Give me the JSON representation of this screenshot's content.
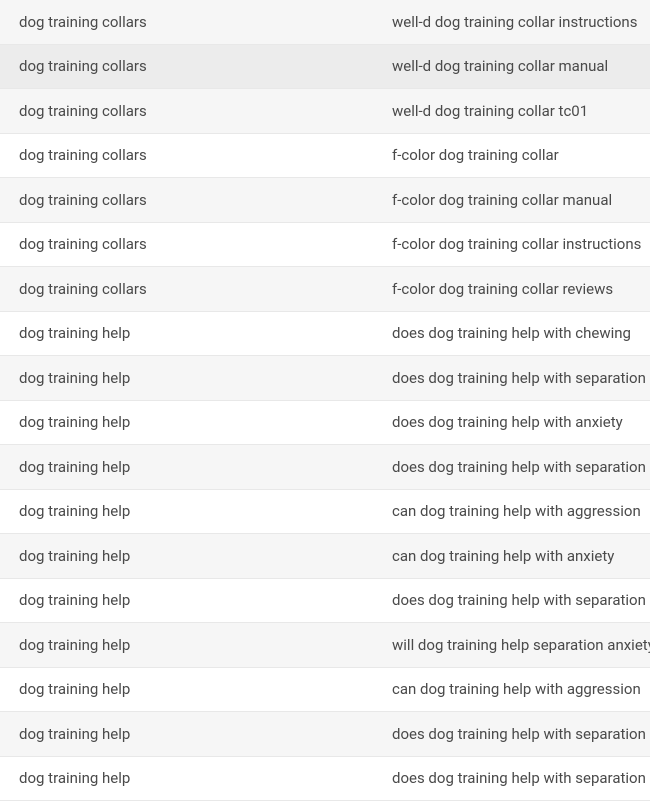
{
  "rows": [
    {
      "category": "dog training collars",
      "query": "well-d dog training collar instructions",
      "style": "alt"
    },
    {
      "category": "dog training collars",
      "query": "well-d dog training collar manual",
      "style": "selected"
    },
    {
      "category": "dog training collars",
      "query": "well-d dog training collar tc01",
      "style": "alt"
    },
    {
      "category": "dog training collars",
      "query": "f-color dog training collar",
      "style": "white"
    },
    {
      "category": "dog training collars",
      "query": "f-color dog training collar manual",
      "style": "alt"
    },
    {
      "category": "dog training collars",
      "query": "f-color dog training collar instructions",
      "style": "white"
    },
    {
      "category": "dog training collars",
      "query": "f-color dog training collar reviews",
      "style": "alt"
    },
    {
      "category": "dog training help",
      "query": "does dog training help with chewing",
      "style": "white"
    },
    {
      "category": "dog training help",
      "query": "does dog training help with separation a",
      "style": "alt"
    },
    {
      "category": "dog training help",
      "query": "does dog training help with anxiety",
      "style": "white"
    },
    {
      "category": "dog training help",
      "query": "does dog training help with separation a",
      "style": "alt"
    },
    {
      "category": "dog training help",
      "query": "can dog training help with aggression",
      "style": "white"
    },
    {
      "category": "dog training help",
      "query": "can dog training help with anxiety",
      "style": "alt"
    },
    {
      "category": "dog training help",
      "query": "does dog training help with separation a",
      "style": "white"
    },
    {
      "category": "dog training help",
      "query": "will dog training help separation anxiety",
      "style": "alt"
    },
    {
      "category": "dog training help",
      "query": "can dog training help with aggression",
      "style": "white"
    },
    {
      "category": "dog training help",
      "query": "does dog training help with separation a",
      "style": "alt"
    },
    {
      "category": "dog training help",
      "query": "does dog training help with separation a",
      "style": "white"
    }
  ]
}
